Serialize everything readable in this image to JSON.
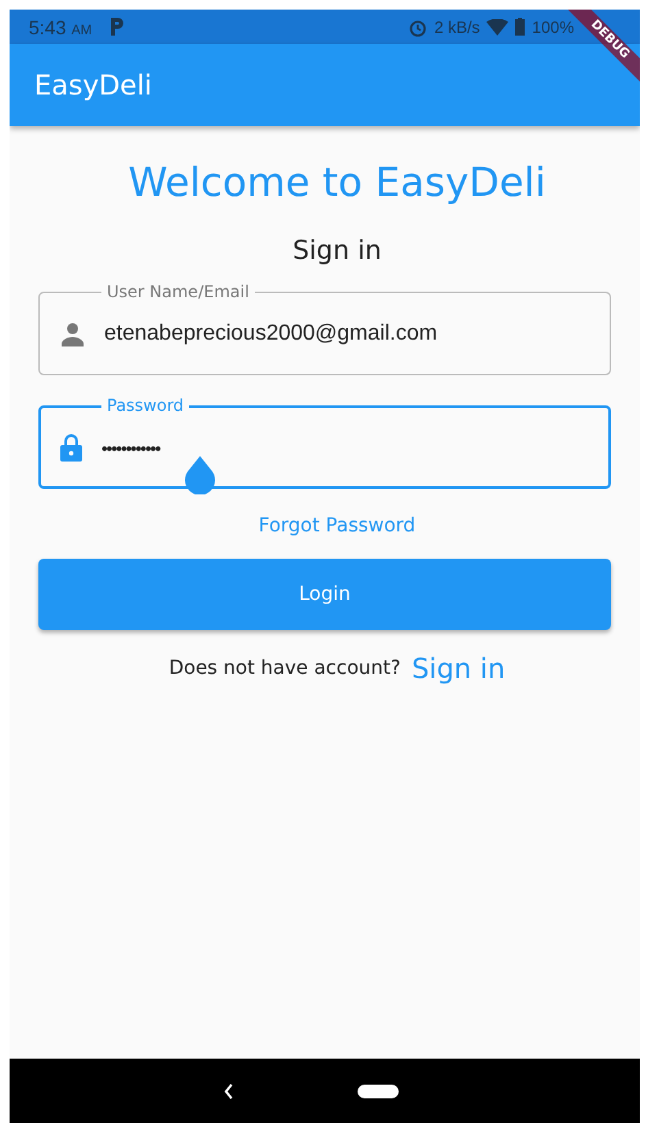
{
  "status_bar": {
    "time": "5:43",
    "ampm": "AM",
    "speed": "2 kB/s",
    "battery": "100%"
  },
  "debug_banner": "DEBUG",
  "app_bar": {
    "title": "EasyDeli"
  },
  "heading": "Welcome to EasyDeli",
  "subheading": "Sign in",
  "fields": [
    {
      "label": "User Name/Email",
      "value": "etenabeprecious2000@gmail.com",
      "kind": "person",
      "focused": false
    },
    {
      "label": "Password",
      "value": "••••••••••••",
      "kind": "lock",
      "focused": true
    }
  ],
  "forgot_link": "Forgot Password",
  "login_button": "Login",
  "signup": {
    "prompt": "Does not have account?",
    "link": "Sign in"
  }
}
